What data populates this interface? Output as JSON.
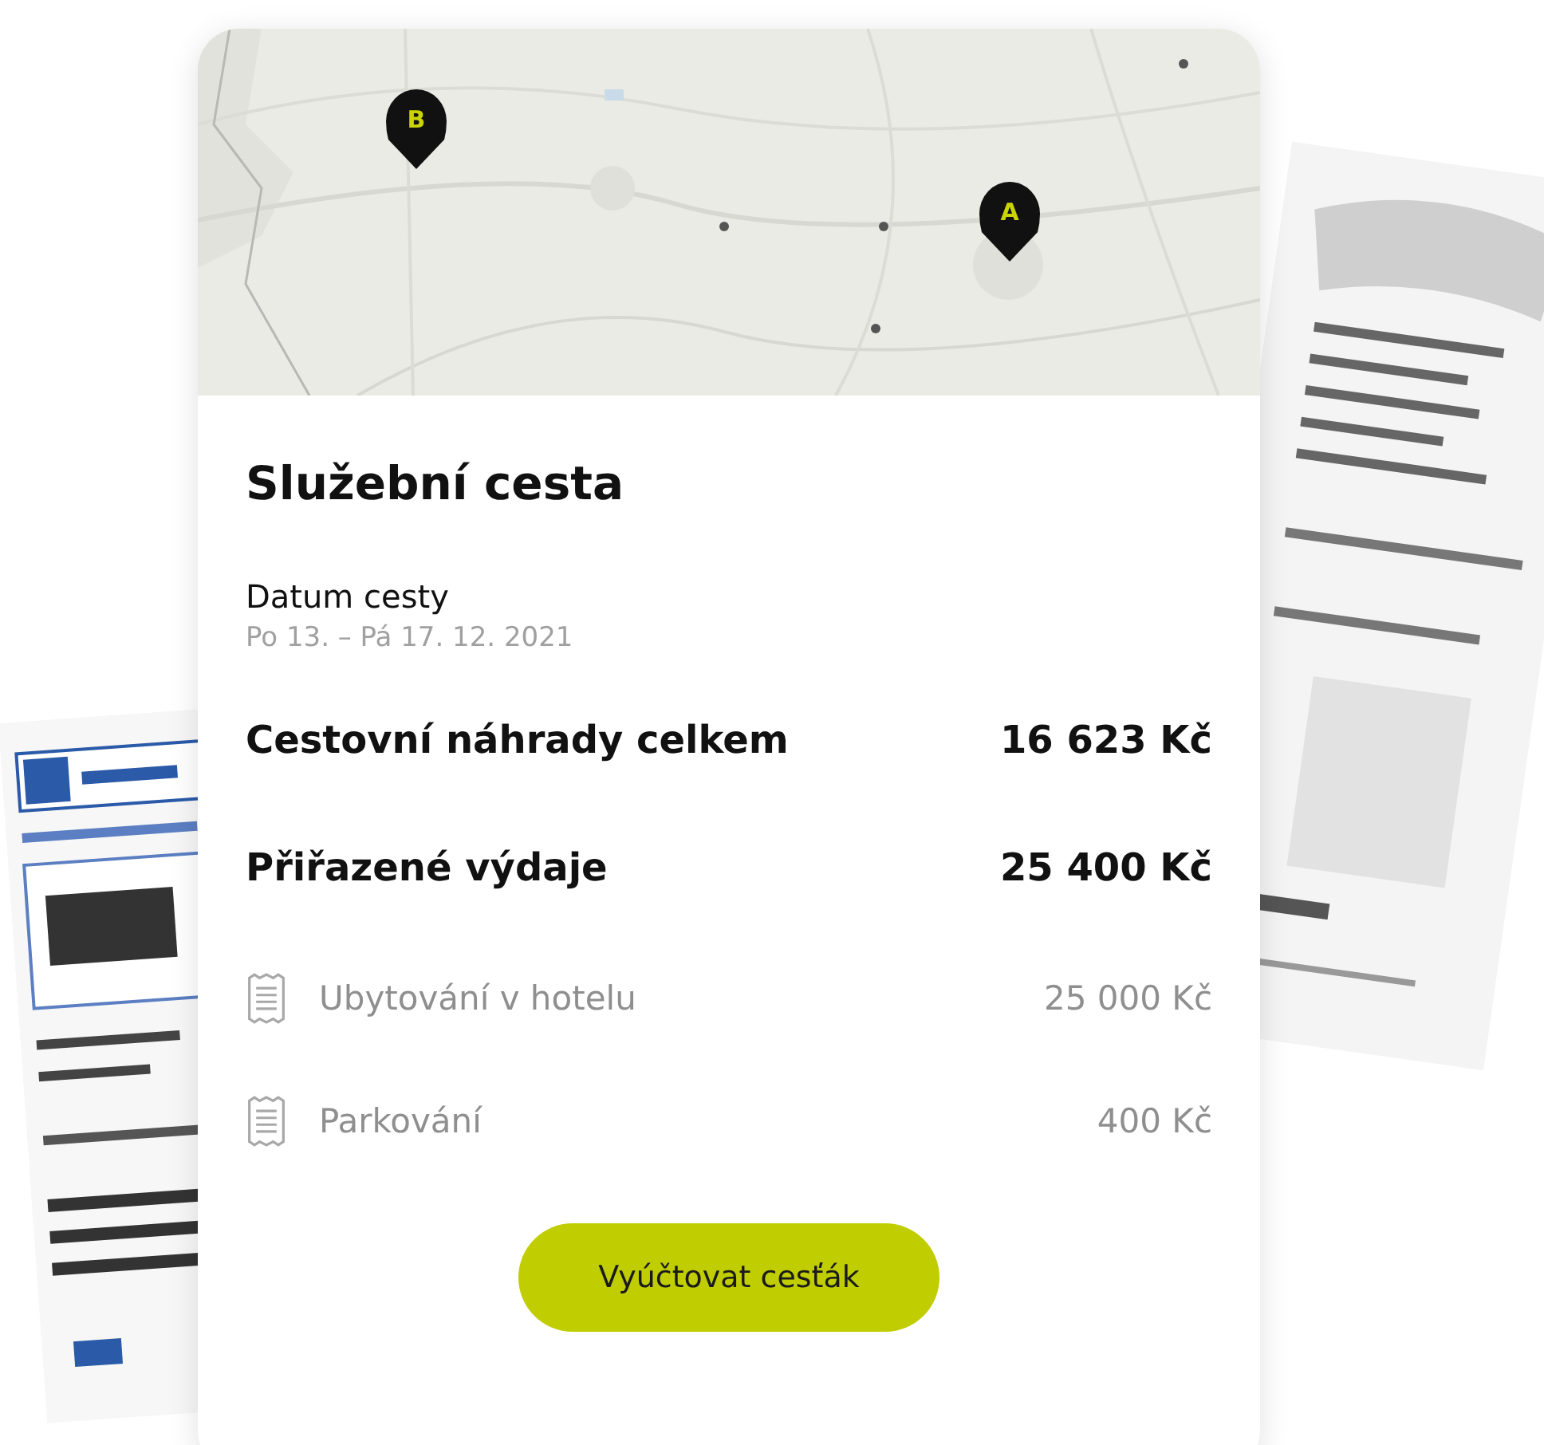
{
  "map": {
    "markers": [
      {
        "label": "B"
      },
      {
        "label": "A"
      }
    ]
  },
  "title": "Služební cesta",
  "date": {
    "label": "Datum cesty",
    "value": "Po 13. – Pá 17. 12. 2021"
  },
  "totals": [
    {
      "label": "Cestovní náhrady celkem",
      "amount": "16 623 Kč"
    },
    {
      "label": "Přiřazené výdaje",
      "amount": "25 400 Kč"
    }
  ],
  "expenses": [
    {
      "label": "Ubytování v hotelu",
      "amount": "25 000 Kč"
    },
    {
      "label": "Parkování",
      "amount": "400 Kč"
    }
  ],
  "button": "Vyúčtovat cesťák"
}
